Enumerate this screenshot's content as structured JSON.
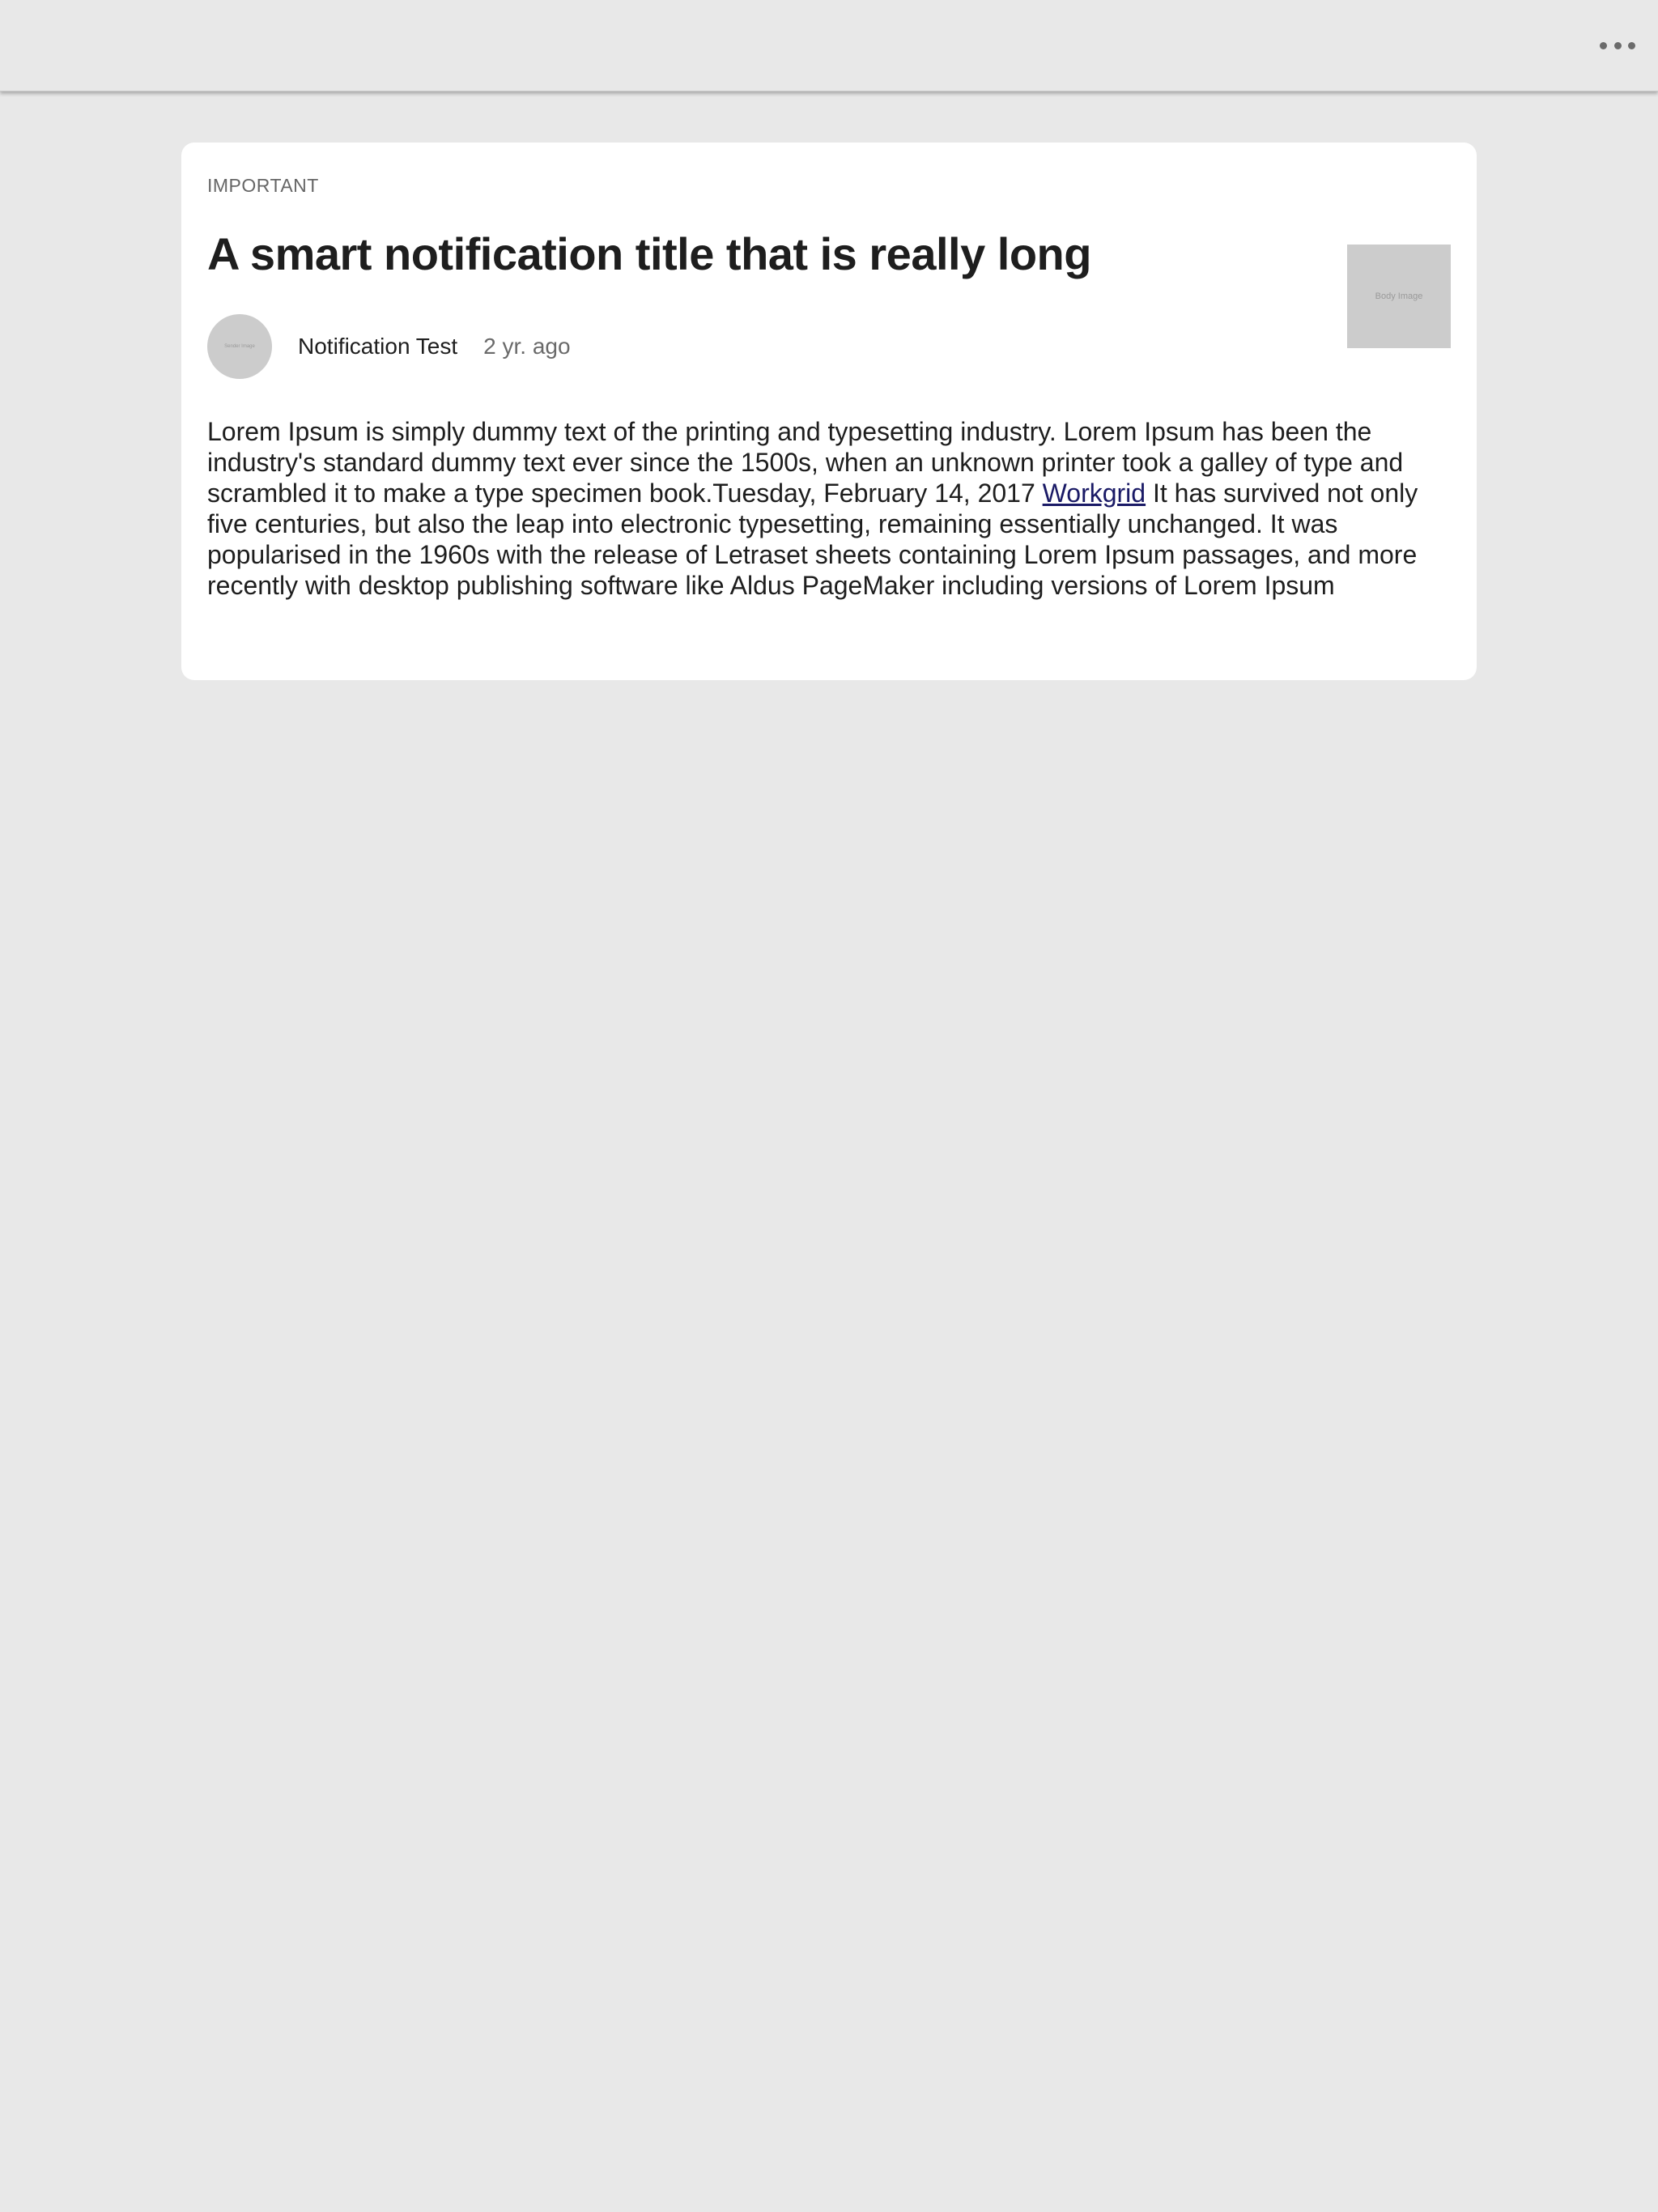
{
  "topbar": {
    "more_icon": "more-horizontal-icon"
  },
  "notification": {
    "category": "IMPORTANT",
    "title": "A smart notification title that is really long",
    "body_image_label": "Body Image",
    "avatar_label": "Sender Image",
    "sender": "Notification Test",
    "time": "2 yr. ago",
    "body_before_link": "Lorem Ipsum is simply dummy text of the printing and typesetting industry. Lorem Ipsum has been the industry's standard dummy text ever since the 1500s, when an unknown printer took a galley of type and scrambled it to make a type specimen book.Tuesday, February 14, 2017 ",
    "link_text": "Workgrid",
    "body_after_link": " It has survived not only five centuries, but also the leap into electronic typesetting, remaining essentially unchanged. It was popularised in the 1960s with the release of Letraset sheets containing Lorem Ipsum passages, and more recently with desktop publishing software like Aldus PageMaker including versions of Lorem Ipsum"
  },
  "colors": {
    "background": "#e8e8e8",
    "card": "#ffffff",
    "link": "#1a1a66",
    "placeholder": "#cccccc"
  }
}
